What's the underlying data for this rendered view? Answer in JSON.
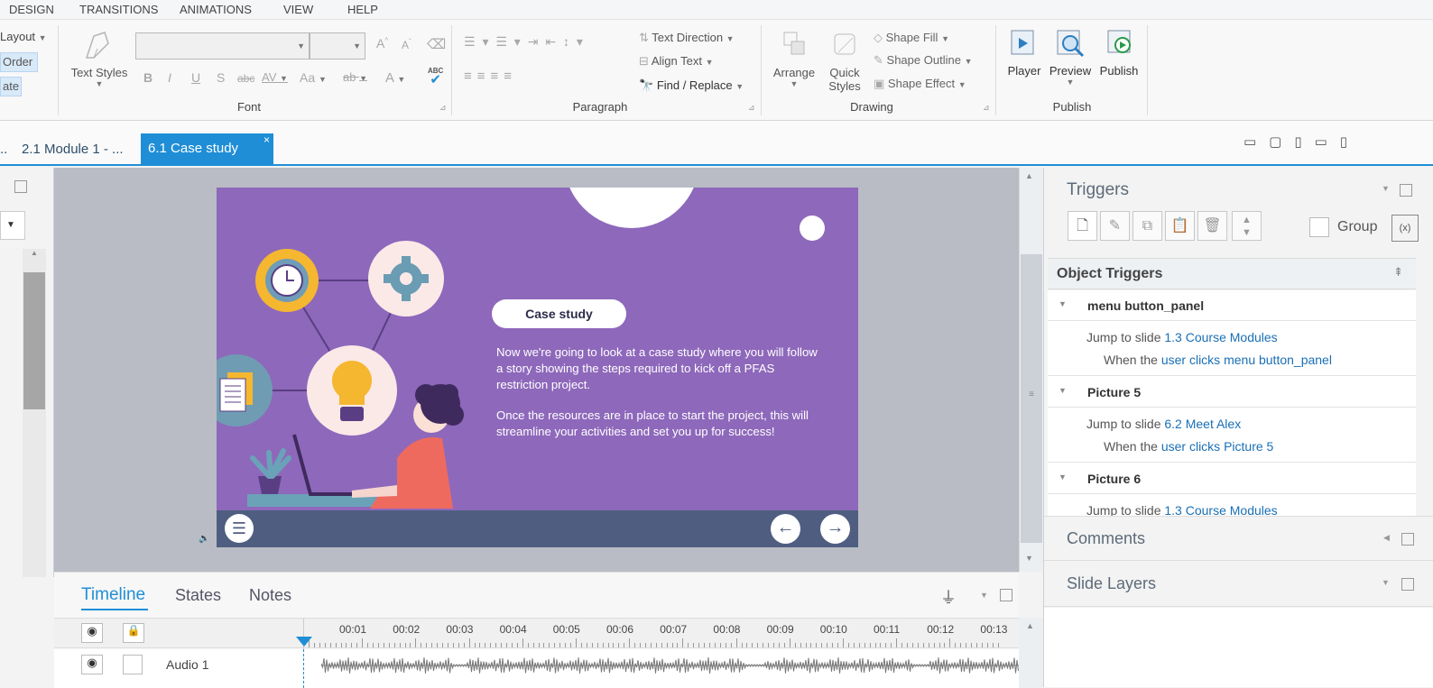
{
  "menu": {
    "items": [
      "DESIGN",
      "TRANSITIONS",
      "ANIMATIONS",
      "VIEW",
      "HELP"
    ]
  },
  "ribbon": {
    "left_fragments": [
      "Layout",
      "Order",
      "ate"
    ],
    "font": {
      "text_styles_label": "Text Styles",
      "group_label": "Font",
      "format_glyphs": [
        "B",
        "I",
        "U",
        "S",
        "abc",
        "AV",
        "Aa",
        "ab",
        "A"
      ],
      "spellcheck_label": "ABC"
    },
    "paragraph": {
      "text_direction": "Text Direction",
      "align_text": "Align Text",
      "find_replace": "Find / Replace",
      "group_label": "Paragraph"
    },
    "drawing": {
      "arrange": "Arrange",
      "quick_styles": "Quick Styles",
      "shape_fill": "Shape Fill",
      "shape_outline": "Shape Outline",
      "shape_effect": "Shape Effect",
      "group_label": "Drawing"
    },
    "publish": {
      "player": "Player",
      "preview": "Preview",
      "publish": "Publish",
      "group_label": "Publish"
    }
  },
  "tabs": [
    {
      "label": ".."
    },
    {
      "label": "2.1 Module 1 - ..."
    },
    {
      "label": "6.1 Case study",
      "active": true
    }
  ],
  "slide": {
    "pill_label": "Case study",
    "paragraph1": "Now we're going to look at a case study where you will follow a story showing the steps required to kick off a PFAS restriction project.",
    "paragraph2": "Once the resources are in place to start the project, this will streamline your activities and set you up for success!",
    "bg_color": "#8e68bb",
    "footer_color": "#4f5e80"
  },
  "triggers": {
    "title": "Triggers",
    "group_label": "Group",
    "object_triggers_label": "Object Triggers",
    "items": [
      {
        "object": "menu button_panel",
        "action": "Jump to slide",
        "target": "1.3 Course Modules",
        "when": "When the",
        "who": "user clicks",
        "source": "menu button_panel"
      },
      {
        "object": "Picture 5",
        "action": "Jump to slide",
        "target": "6.2 Meet Alex",
        "when": "When the",
        "who": "user clicks",
        "source": "Picture 5"
      },
      {
        "object": "Picture 6",
        "action": "Jump to slide",
        "target": "1.3 Course Modules"
      }
    ]
  },
  "panels": {
    "comments": "Comments",
    "slide_layers": "Slide Layers"
  },
  "timeline": {
    "tabs": [
      "Timeline",
      "States",
      "Notes"
    ],
    "ticks": [
      "00:01",
      "00:02",
      "00:03",
      "00:04",
      "00:05",
      "00:06",
      "00:07",
      "00:08",
      "00:09",
      "00:10",
      "00:11",
      "00:12",
      "00:13"
    ],
    "rows": [
      {
        "label": "Audio 1"
      }
    ]
  },
  "colors": {
    "accent": "#1f8ed6",
    "link": "#1a6fb5"
  }
}
